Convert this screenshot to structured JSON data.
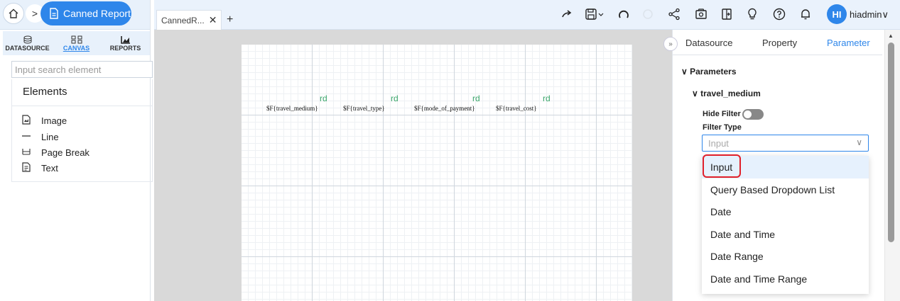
{
  "header": {
    "report_button_label": "Canned Report"
  },
  "tabs": {
    "active_tab_label": "CannedR...",
    "close_glyph": "✕",
    "add_glyph": "+"
  },
  "toolbar": {
    "icons": [
      "redo-icon",
      "save-icon",
      "refresh-icon",
      "loading-icon",
      "share-icon",
      "preview-icon",
      "export-icon",
      "bulb-icon",
      "help-icon",
      "bell-icon"
    ]
  },
  "user": {
    "initials": "HI",
    "name": "hiadmin"
  },
  "left_panel": {
    "tabs": [
      {
        "label": "DATASOURCE",
        "icon": "datasource-icon"
      },
      {
        "label": "CANVAS",
        "icon": "canvas-icon"
      },
      {
        "label": "REPORTS",
        "icon": "reports-icon"
      }
    ],
    "search_placeholder": "Input search element",
    "elements_heading": "Elements",
    "elements": [
      {
        "label": "Image",
        "icon": "image-icon"
      },
      {
        "label": "Line",
        "icon": "line-icon"
      },
      {
        "label": "Page Break",
        "icon": "page-break-icon"
      },
      {
        "label": "Text",
        "icon": "text-icon"
      }
    ]
  },
  "canvas": {
    "fields": [
      "$F{travel_medium}",
      "$F{travel_type}",
      "$F{mode_of_payment}",
      "$F{travel_cost}"
    ],
    "rd_marker": "rd"
  },
  "right_panel": {
    "tabs": [
      "Datasource",
      "Property",
      "Parameter"
    ],
    "active_tab": "Parameter",
    "parameters_heading": "Parameters",
    "parameter_name": "travel_medium",
    "hide_filter_label": "Hide Filter",
    "filter_type_label": "Filter Type",
    "filter_type_value": "Input",
    "filter_type_options": [
      "Input",
      "Query Based Dropdown List",
      "Date",
      "Date and Time",
      "Date Range",
      "Date and Time Range"
    ]
  },
  "colors": {
    "accent": "#2e86ea",
    "highlight_box": "#e0202a",
    "rd_green": "#3aa56a"
  }
}
